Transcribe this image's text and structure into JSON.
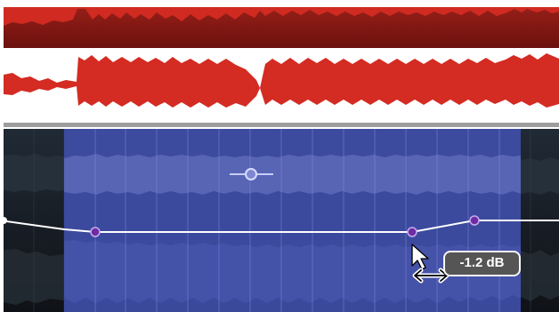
{
  "app": {
    "view": "waveform-gain-envelope-editor"
  },
  "tooltip": {
    "gain_label": "-1.2 dB"
  },
  "colors": {
    "top_track_waveform": "#d42b22",
    "top_track_background": "#7a1a14",
    "selection_fill": "#3f4ea7",
    "envelope_line": "#d9dcf5",
    "envelope_node": "#7b2fb7",
    "tooltip_background": "#555555"
  },
  "icons": {
    "cursor": "mouse-pointer-icon",
    "resize": "horizontal-resize-arrow-icon",
    "handle": "gain-handle-icon"
  }
}
